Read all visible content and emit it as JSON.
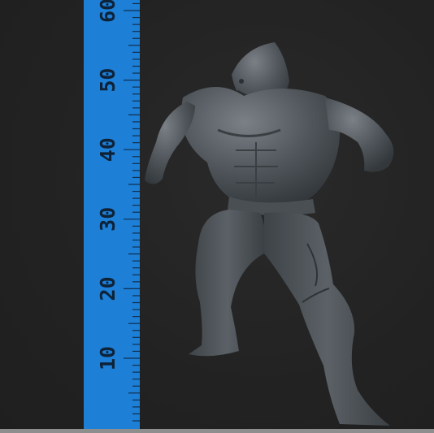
{
  "viewport": {
    "background": "#232323"
  },
  "ruler": {
    "color": "#1d7fd6",
    "tick_color": "#0f2f52",
    "label_color": "#0e2238",
    "labels": [
      "10",
      "20",
      "30",
      "40",
      "50",
      "60"
    ]
  },
  "model": {
    "name": "shark-man-miniature",
    "color": "#555b60"
  }
}
